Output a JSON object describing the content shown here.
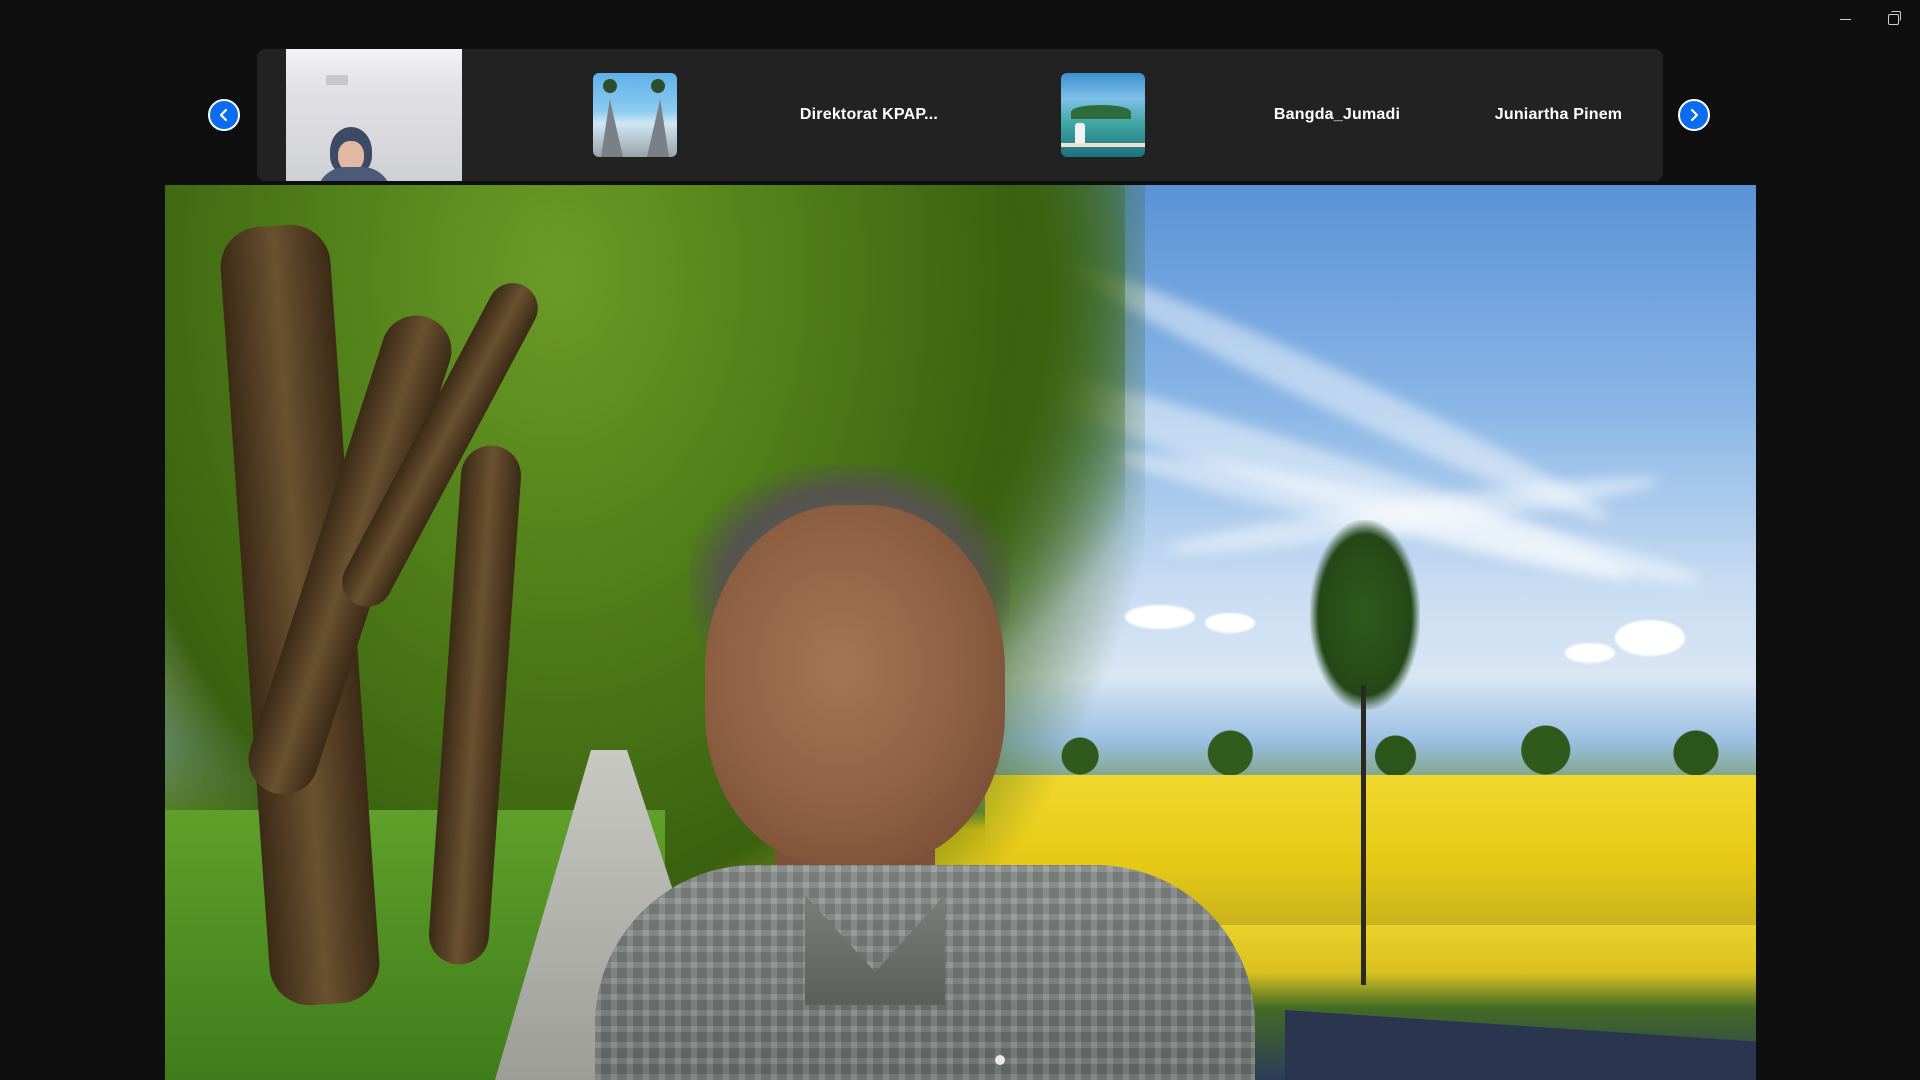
{
  "window": {
    "controls": {
      "minimize_icon": "minimize-icon",
      "restore_icon": "restore-icon"
    }
  },
  "gallery": {
    "prev_icon": "chevron-left-icon",
    "next_icon": "chevron-right-icon",
    "tiles": [
      {
        "type": "video",
        "name": ""
      },
      {
        "type": "avatar",
        "name": ""
      },
      {
        "type": "name",
        "name": "Direktorat  KPAP..."
      },
      {
        "type": "avatar",
        "name": ""
      },
      {
        "type": "name",
        "name": "Bangda_Jumadi"
      },
      {
        "type": "name",
        "name": "Juniartha Pinem"
      }
    ]
  },
  "colors": {
    "background": "#0f0f10",
    "strip": "#222223",
    "nav_button": "#0b6cf0"
  }
}
